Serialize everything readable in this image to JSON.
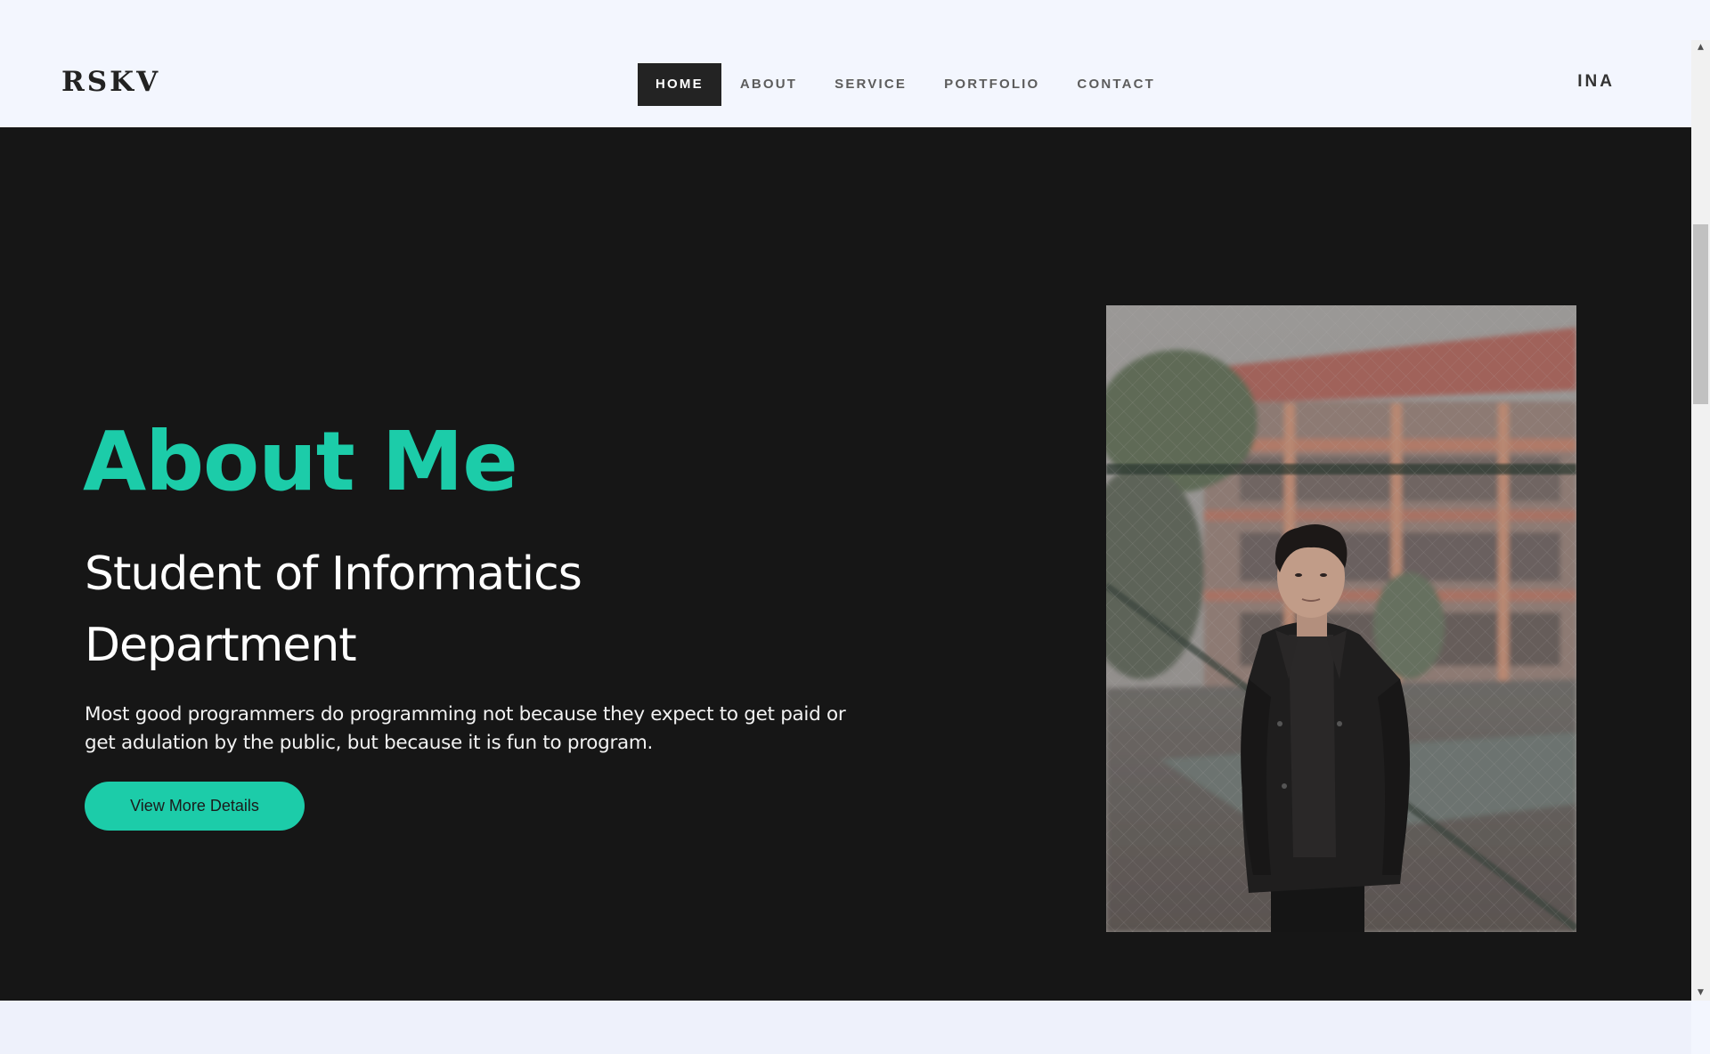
{
  "header": {
    "logo": "RSKV",
    "nav": [
      {
        "label": "HOME",
        "active": true
      },
      {
        "label": "ABOUT",
        "active": false
      },
      {
        "label": "SERVICE",
        "active": false
      },
      {
        "label": "PORTFOLIO",
        "active": false
      },
      {
        "label": "CONTACT",
        "active": false
      }
    ],
    "language": "INA"
  },
  "hero": {
    "title": "About Me",
    "subtitle": "Student of Informatics Department",
    "text": "Most good programmers do programming not because they expect to get paid or get adulation by the public, but because it is fun to program.",
    "button_label": "View More Details"
  },
  "colors": {
    "accent": "#1ccca9",
    "hero_background": "#161616",
    "page_background": "#f3f6fe",
    "nav_active_background": "#232323"
  },
  "scrollbar": {
    "up_icon": "scroll-up-arrow",
    "down_icon": "scroll-down-arrow"
  }
}
